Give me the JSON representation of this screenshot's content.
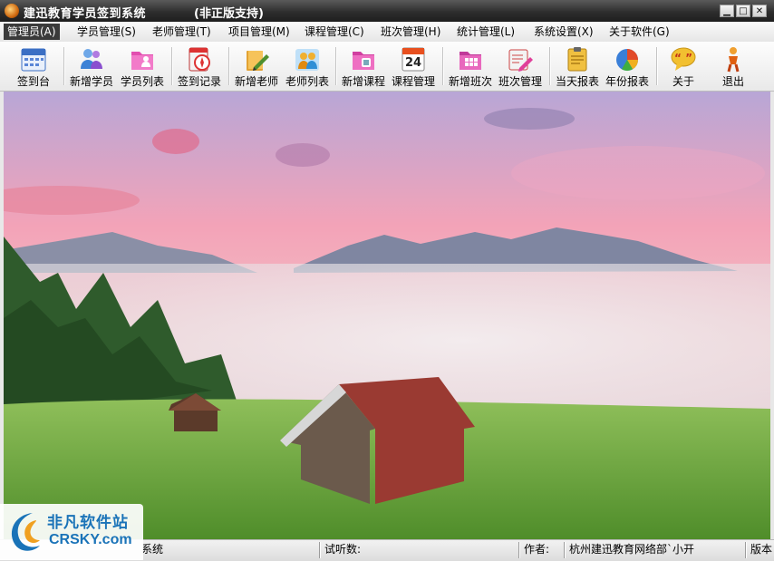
{
  "window": {
    "title": "建迅教育学员签到系统",
    "title_extra": "(非正版支持)",
    "buttons": {
      "minimize": "▁",
      "maximize": "□",
      "close": "✕"
    }
  },
  "menu": [
    {
      "label": "管理员(A)",
      "active": true
    },
    {
      "label": "学员管理(S)"
    },
    {
      "label": "老师管理(T)"
    },
    {
      "label": "项目管理(M)"
    },
    {
      "label": "课程管理(C)"
    },
    {
      "label": "班次管理(H)"
    },
    {
      "label": "统计管理(L)"
    },
    {
      "label": "系统设置(X)"
    },
    {
      "label": "关于软件(G)"
    }
  ],
  "toolbar": [
    {
      "label": "签到台",
      "icon": "calendar-icon"
    },
    {
      "label": "新增学员",
      "icon": "add-users-icon"
    },
    {
      "label": "学员列表",
      "icon": "user-folder-icon"
    },
    {
      "label": "签到记录",
      "icon": "record-compass-icon"
    },
    {
      "label": "新增老师",
      "icon": "pencil-book-icon"
    },
    {
      "label": "老师列表",
      "icon": "teachers-icon"
    },
    {
      "label": "新增课程",
      "icon": "course-folder-icon"
    },
    {
      "label": "课程管理",
      "icon": "calendar-24-icon",
      "badge": "24"
    },
    {
      "label": "新增班次",
      "icon": "grid-folder-icon"
    },
    {
      "label": "班次管理",
      "icon": "edit-pen-icon"
    },
    {
      "label": "当天报表",
      "icon": "report-clip-icon"
    },
    {
      "label": "年份报表",
      "icon": "pie-chart-icon"
    },
    {
      "label": "关于",
      "icon": "speech-bubble-icon"
    },
    {
      "label": "退出",
      "icon": "exit-person-icon"
    }
  ],
  "status": {
    "system": "系统",
    "trial_label": "试听数:",
    "trial_value": "",
    "author_label": "作者:",
    "author_value": "杭州建迅教育网络部`小开",
    "version_label": "版本"
  },
  "watermark": {
    "cn": "非凡软件站",
    "en": "CRSKY.com"
  },
  "colors": {
    "titlebar": "#2e2e2e",
    "menu_active": "#3a3a3a",
    "watermark_blue": "#1a73b8"
  }
}
